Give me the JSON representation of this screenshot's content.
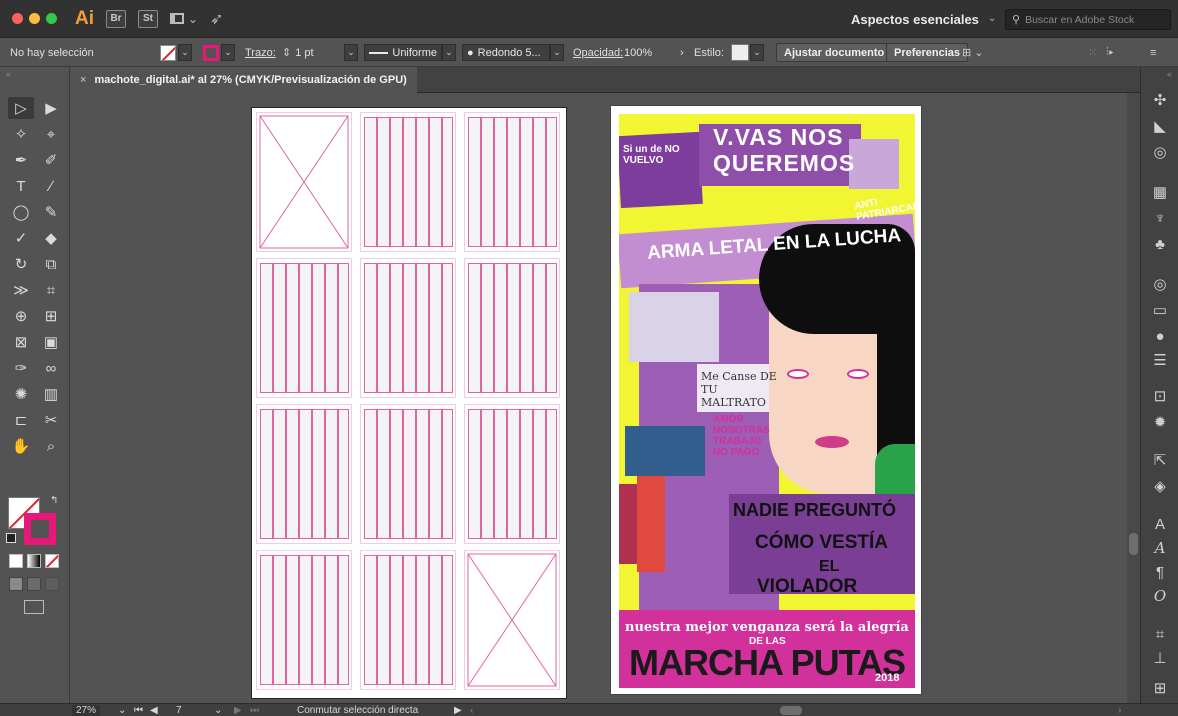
{
  "app": {
    "logo": "Ai",
    "bridge": "Br",
    "stock": "St"
  },
  "titlebar": {
    "workspace_name": "Aspectos esenciales",
    "stock_search_placeholder": "Buscar en Adobe Stock",
    "colors": {
      "close": "#fc615d",
      "minimize": "#fdbc40",
      "zoom": "#34c84a"
    }
  },
  "controlbar": {
    "selection_status": "No hay selección",
    "stroke_label": "Trazo:",
    "stroke_value": "1 pt",
    "profile": "Uniforme",
    "brush": "Redondo 5...",
    "opacity_label": "Opacidad:",
    "opacity_value": "100%",
    "style_label": "Estilo:",
    "fit_document": "Ajustar documento",
    "preferences": "Preferencias"
  },
  "document": {
    "tab_title": "machote_digital.ai* al 27% (CMYK/Previsualización de GPU)",
    "tab_close": "×"
  },
  "poster": {
    "line1": "V.VAS NOS",
    "line2": "QUEREMOS",
    "line3": "ARMA LETAL EN LA LUCHA",
    "line4": "ANTI PATRIARCAL",
    "sign1": "NADIE PREGUNTÓ",
    "sign2": "CÓMO VESTÍA",
    "sign3": "EL",
    "sign4": "VIOLADOR",
    "banner": "nuestra mejor venganza será la alegría",
    "de_las": "DE LAS",
    "title": "MARCHA PUTAS",
    "year": "2018",
    "small1": "Me Canse DE TU MALTRATO",
    "small2": "AMOR NOSOTRAS TRABAJO NO PAGO",
    "small3": "Si un de NO VUELVO",
    "colors": {
      "background": "#f2f531",
      "purple": "#9c5fb5",
      "magenta": "#d2309a"
    }
  },
  "statusbar": {
    "zoom": "27%",
    "artboard_number": "7",
    "tool_status": "Conmutar selección directa"
  }
}
